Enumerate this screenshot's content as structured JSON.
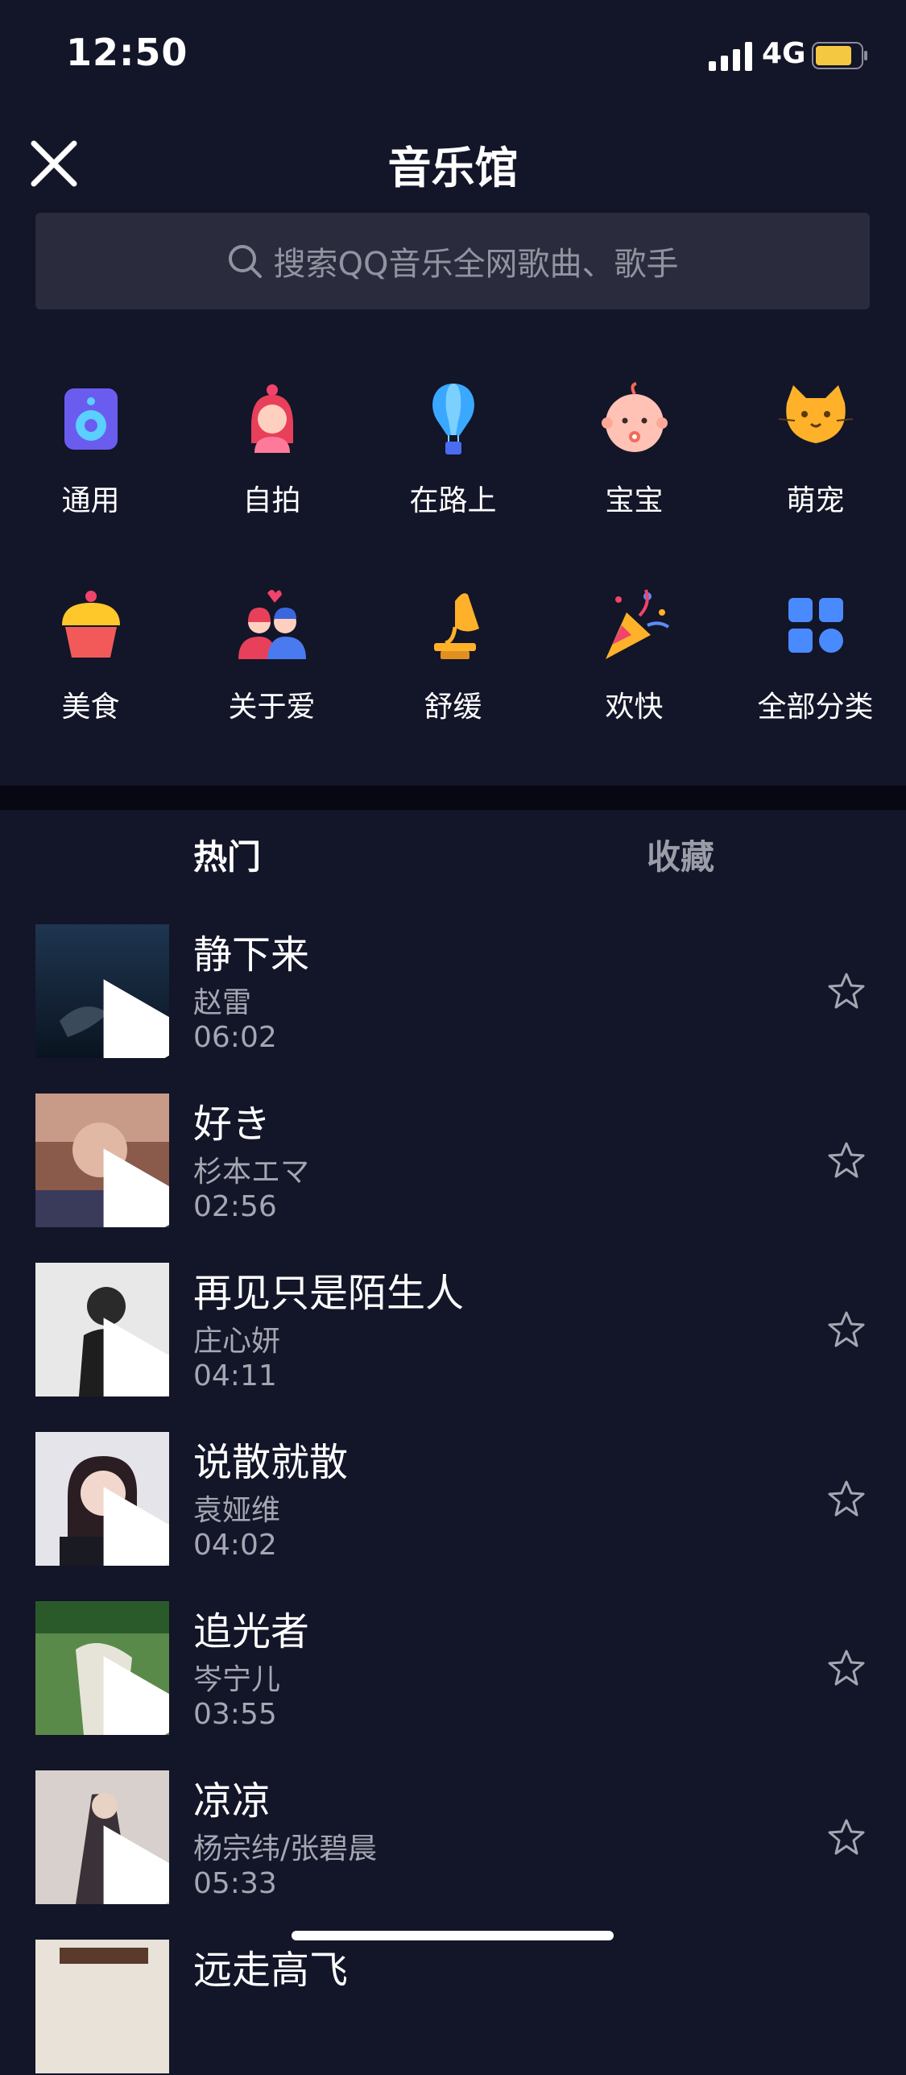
{
  "status": {
    "time": "12:50",
    "network": "4G"
  },
  "header": {
    "title": "音乐馆"
  },
  "search": {
    "placeholder": "搜索QQ音乐全网歌曲、歌手"
  },
  "categories": [
    {
      "label": "通用",
      "icon": "speaker-icon"
    },
    {
      "label": "自拍",
      "icon": "girl-icon"
    },
    {
      "label": "在路上",
      "icon": "balloon-icon"
    },
    {
      "label": "宝宝",
      "icon": "baby-icon"
    },
    {
      "label": "萌宠",
      "icon": "cat-icon"
    },
    {
      "label": "美食",
      "icon": "cupcake-icon"
    },
    {
      "label": "关于爱",
      "icon": "couple-icon"
    },
    {
      "label": "舒缓",
      "icon": "gramophone-icon"
    },
    {
      "label": "欢快",
      "icon": "party-popper-icon"
    },
    {
      "label": "全部分类",
      "icon": "grid-icon"
    }
  ],
  "tabs": {
    "hot": "热门",
    "favorites": "收藏"
  },
  "songs": [
    {
      "title": "静下来",
      "artist": "赵雷",
      "duration": "06:02"
    },
    {
      "title": "好き",
      "artist": "杉本エマ",
      "duration": "02:56"
    },
    {
      "title": "再见只是陌生人",
      "artist": "庄心妍",
      "duration": "04:11"
    },
    {
      "title": "说散就散",
      "artist": "袁娅维",
      "duration": "04:02"
    },
    {
      "title": "追光者",
      "artist": "岑宁儿",
      "duration": "03:55"
    },
    {
      "title": "凉凉",
      "artist": "杨宗纬/张碧晨",
      "duration": "05:33"
    },
    {
      "title": "远走高飞",
      "artist": "",
      "duration": ""
    }
  ],
  "colors": {
    "background": "#131528",
    "search_bg": "#2a2c3d",
    "divider": "#070812",
    "secondary_text": "#a4a6b2"
  }
}
